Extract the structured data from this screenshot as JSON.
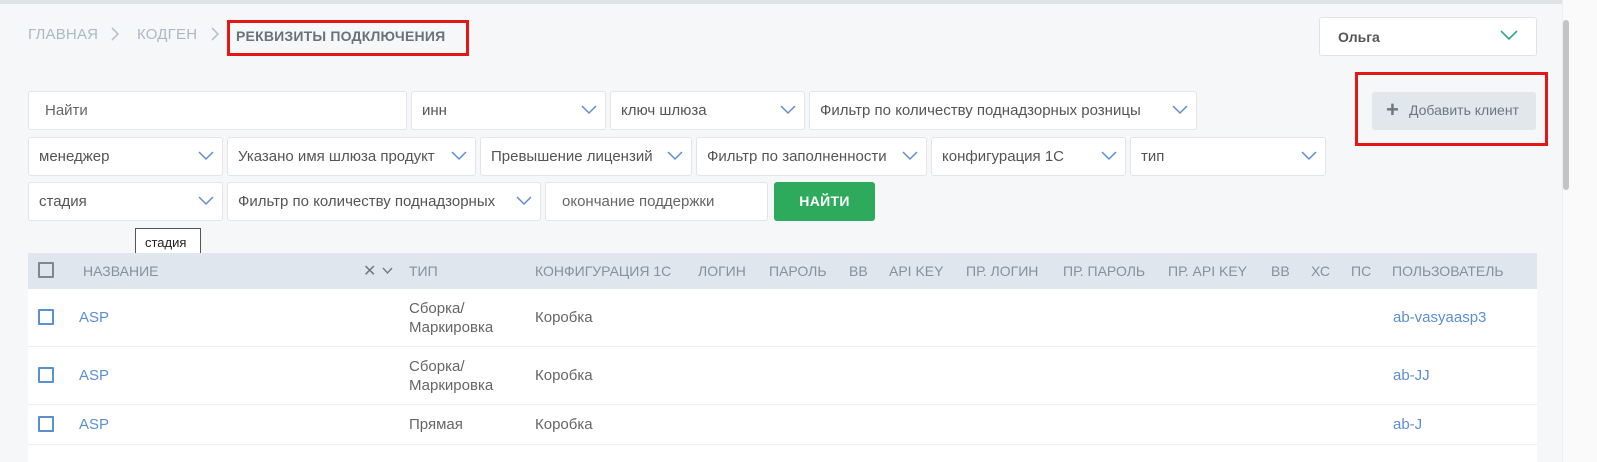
{
  "breadcrumb": {
    "items": [
      "ГЛАВНАЯ",
      "КОДГЕН"
    ],
    "current": "РЕКВИЗИТЫ ПОДКЛЮЧЕНИЯ"
  },
  "user_menu": {
    "selected": "Ольга"
  },
  "add_client_button": {
    "label": "Добавить клиент"
  },
  "filters": {
    "search_placeholder": "Найти",
    "inn": "инн",
    "gateway_key": "ключ шлюза",
    "retail_count": "Фильтр по количеству поднадзорных розницы",
    "manager": "менеджер",
    "gateway_name_specified": "Указано имя шлюза продукт",
    "license_excess": "Превышение лицензий",
    "fill_filter": "Фильтр по заполненности",
    "configuration": "конфигурация 1С",
    "type": "тип",
    "stage": "стадия",
    "supervised_count": "Фильтр по количеству поднадзорных",
    "support_end_placeholder": "окончание поддержки",
    "find_button": "НАЙТИ"
  },
  "tooltip": {
    "text": "стадия"
  },
  "table": {
    "headers": [
      "НАЗВАНИЕ",
      "ТИП",
      "КОНФИГУРАЦИЯ 1С",
      "ЛОГИН",
      "ПАРОЛЬ",
      "ВВ",
      "API KEY",
      "ПР. ЛОГИН",
      "ПР. ПАРОЛЬ",
      "ПР. API KEY",
      "ВВ",
      "ХС",
      "ПС",
      "ПОЛЬЗОВАТЕЛЬ"
    ],
    "rows": [
      {
        "name": "ASP",
        "type_line1": "Сборка/",
        "type_line2": "Маркировка",
        "config": "Коробка",
        "user": "ab-vasyaasp3"
      },
      {
        "name": "ASP",
        "type_line1": "Сборка/",
        "type_line2": "Маркировка",
        "config": "Коробка",
        "user": "ab-JJ"
      },
      {
        "name": "ASP",
        "type_line1": "Прямая",
        "type_line2": "",
        "config": "Коробка",
        "user": "ab-J"
      }
    ]
  },
  "icons": {
    "dropdown": "chevron-down-icon",
    "add": "plus-icon",
    "clear": "close-icon"
  },
  "colors": {
    "accent_green": "#2eaa5c",
    "link_blue": "#5b8fd1",
    "highlight_red": "#e51616"
  }
}
